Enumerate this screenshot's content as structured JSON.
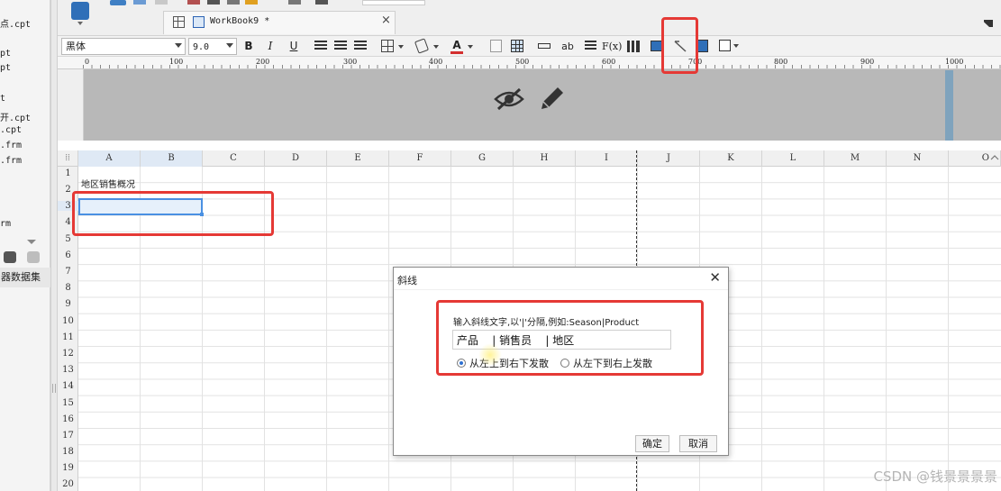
{
  "left_panel": {
    "files": [
      "点.cpt",
      "pt",
      "pt",
      "t",
      "开.cpt",
      ".cpt",
      ".frm",
      ".frm",
      "rm"
    ],
    "dataset_label": "器数据集"
  },
  "tab": {
    "title": "WorkBook9 *",
    "close": "×"
  },
  "toolbar": {
    "font_name": "黑体",
    "font_size": "9.0",
    "bold": "B",
    "italic": "I",
    "underline": "U",
    "text_color_glyph": "A",
    "ab": "ab",
    "fx": "F(x)"
  },
  "ruler": {
    "marks": [
      "0",
      "100",
      "200",
      "300",
      "400",
      "500",
      "600",
      "700",
      "800",
      "900",
      "1000"
    ]
  },
  "column_headers": [
    "A",
    "B",
    "C",
    "D",
    "E",
    "F",
    "G",
    "H",
    "I",
    "J",
    "K",
    "L",
    "M",
    "N",
    "O"
  ],
  "row_headers": [
    "1",
    "2",
    "3",
    "4",
    "5",
    "6",
    "7",
    "8",
    "9",
    "10",
    "11",
    "12",
    "13",
    "14",
    "15",
    "16",
    "17",
    "18",
    "19",
    "20"
  ],
  "cells": {
    "a2": "地区销售概况"
  },
  "dialog": {
    "title": "斜线",
    "close": "✕",
    "prompt": "输入斜线文字,以'|'分隔,例如:Season|Product",
    "input_value": "产品    | 销售员    | 地区",
    "radio1": "从左上到右下发散",
    "radio2": "从左下到右上发散",
    "ok": "确定",
    "cancel": "取消"
  },
  "watermark": "CSDN @钱景景景景"
}
